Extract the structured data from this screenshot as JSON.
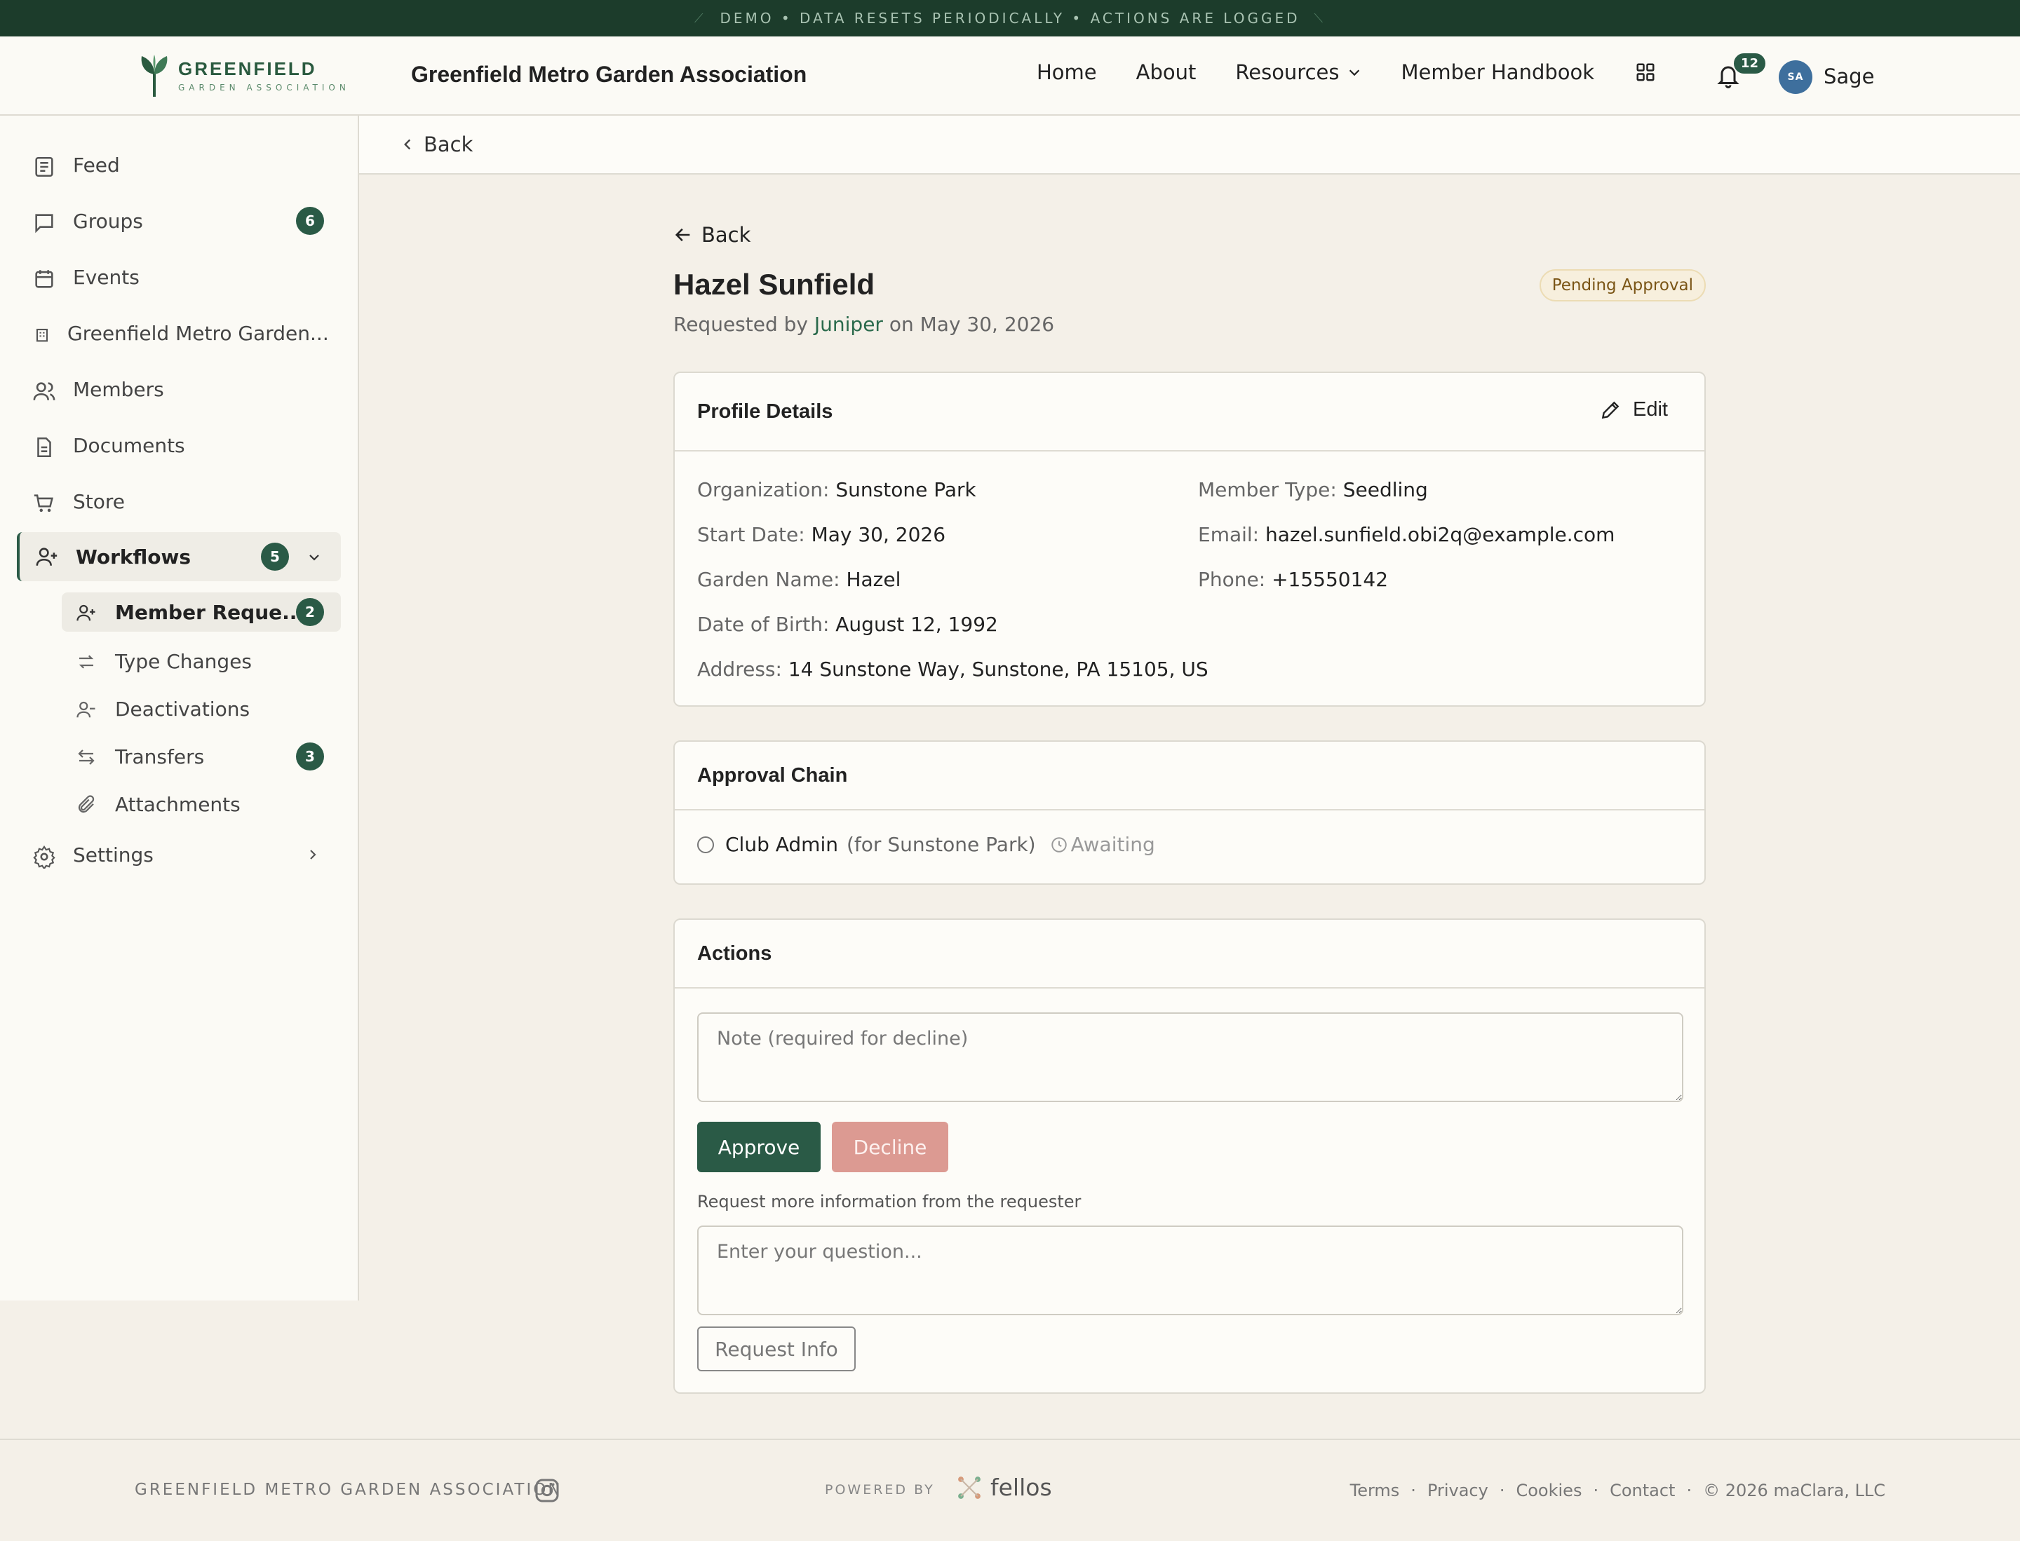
{
  "banner": {
    "text": "DEMO • DATA RESETS PERIODICALLY • ACTIONS ARE LOGGED"
  },
  "header": {
    "logo_name": "GREENFIELD",
    "logo_sub": "GARDEN ASSOCIATION",
    "org_title": "Greenfield Metro Garden Association",
    "nav": [
      "Home",
      "About",
      "Resources",
      "Member Handbook"
    ],
    "notification_count": "12",
    "avatar_initials": "SA",
    "user_name": "Sage"
  },
  "sidebar": {
    "items": [
      {
        "label": "Feed",
        "icon": "newspaper-icon"
      },
      {
        "label": "Groups",
        "icon": "chat-bubble-icon",
        "badge": "6"
      },
      {
        "label": "Events",
        "icon": "calendar-icon"
      },
      {
        "label": "Greenfield Metro Garden...",
        "icon": "building-icon"
      },
      {
        "label": "Members",
        "icon": "users-icon"
      },
      {
        "label": "Documents",
        "icon": "document-icon"
      },
      {
        "label": "Store",
        "icon": "cart-icon"
      },
      {
        "label": "Workflows",
        "icon": "user-plus-icon",
        "badge": "5"
      },
      {
        "label": "Settings",
        "icon": "gear-icon"
      }
    ],
    "workflow_items": [
      {
        "label": "Member Reque...",
        "badge": "2",
        "icon": "user-plus-icon"
      },
      {
        "label": "Type Changes",
        "icon": "swap-icon"
      },
      {
        "label": "Deactivations",
        "icon": "user-minus-icon"
      },
      {
        "label": "Transfers",
        "badge": "3",
        "icon": "transfer-icon"
      },
      {
        "label": "Attachments",
        "icon": "paperclip-icon"
      }
    ]
  },
  "backbar": {
    "label": "Back"
  },
  "request": {
    "back_label": "Back",
    "name": "Hazel Sunfield",
    "status": "Pending Approval",
    "requested_prefix": "Requested by",
    "requester": "Juniper",
    "requested_suffix": "on May 30, 2026"
  },
  "profile": {
    "title": "Profile Details",
    "edit_label": "Edit",
    "fields": [
      {
        "label": "Organization:",
        "value": "Sunstone Park"
      },
      {
        "label": "Start Date:",
        "value": "May 30, 2026"
      },
      {
        "label": "Garden Name:",
        "value": "Hazel"
      },
      {
        "label": "Date of Birth:",
        "value": "August 12, 1992"
      },
      {
        "label": "Address:",
        "value": "14 Sunstone Way, Sunstone, PA 15105, US"
      },
      {
        "label": "Member Type:",
        "value": "Seedling"
      },
      {
        "label": "Email:",
        "value": "hazel.sunfield.obi2q@example.com"
      },
      {
        "label": "Phone:",
        "value": "+15550142"
      }
    ]
  },
  "approval_chain": {
    "title": "Approval Chain",
    "role": "Club Admin",
    "scope": "(for Sunstone Park)",
    "state": "Awaiting"
  },
  "actions": {
    "title": "Actions",
    "note_placeholder": "Note (required for decline)",
    "approve_label": "Approve",
    "decline_label": "Decline",
    "request_info_label": "Request more information from the requester",
    "question_placeholder": "Enter your question...",
    "request_info_button": "Request Info"
  },
  "footer": {
    "org": "GREENFIELD METRO GARDEN ASSOCIATION",
    "powered_by": "POWERED BY",
    "brand": "fellos",
    "links": [
      "Terms",
      "Privacy",
      "Cookies",
      "Contact"
    ],
    "copyright": "© 2026 maClara, LLC"
  },
  "colors": {
    "brand_green": "#2a5a46",
    "banner": "#1c3c2b",
    "decline": "#dc9a92",
    "pending_bg": "#f7efdd"
  }
}
